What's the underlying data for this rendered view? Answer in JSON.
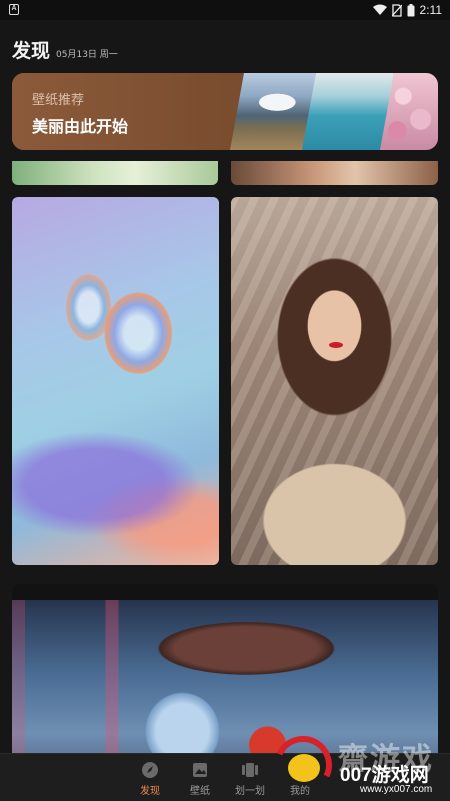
{
  "status_bar": {
    "time": "2:11",
    "app_icon": "A",
    "icons": [
      "wifi-icon",
      "no-sim-icon",
      "battery-icon"
    ]
  },
  "header": {
    "title": "发现",
    "date": "05月13日 周一"
  },
  "banner": {
    "subtitle": "壁纸推荐",
    "title": "美丽由此开始"
  },
  "cards": [
    {
      "name": "glass-bubbles-wallpaper"
    },
    {
      "name": "girl-portrait-wallpaper"
    },
    {
      "name": "anime-umbrella-wallpaper"
    }
  ],
  "bottom_nav": {
    "items": [
      {
        "label": "发现",
        "icon": "discover-icon",
        "active": true
      },
      {
        "label": "壁纸",
        "icon": "wallpaper-icon",
        "active": false
      },
      {
        "label": "划一划",
        "icon": "swipe-icon",
        "active": false
      },
      {
        "label": "我的",
        "icon": "profile-icon",
        "active": false
      }
    ]
  },
  "watermark": {
    "cn": "齋游戏",
    "sub": "007游戏网",
    "url": "www.yx007.com"
  },
  "colors": {
    "background": "#161616",
    "banner": "#8b5a3a",
    "accent": "#e98a4b"
  }
}
